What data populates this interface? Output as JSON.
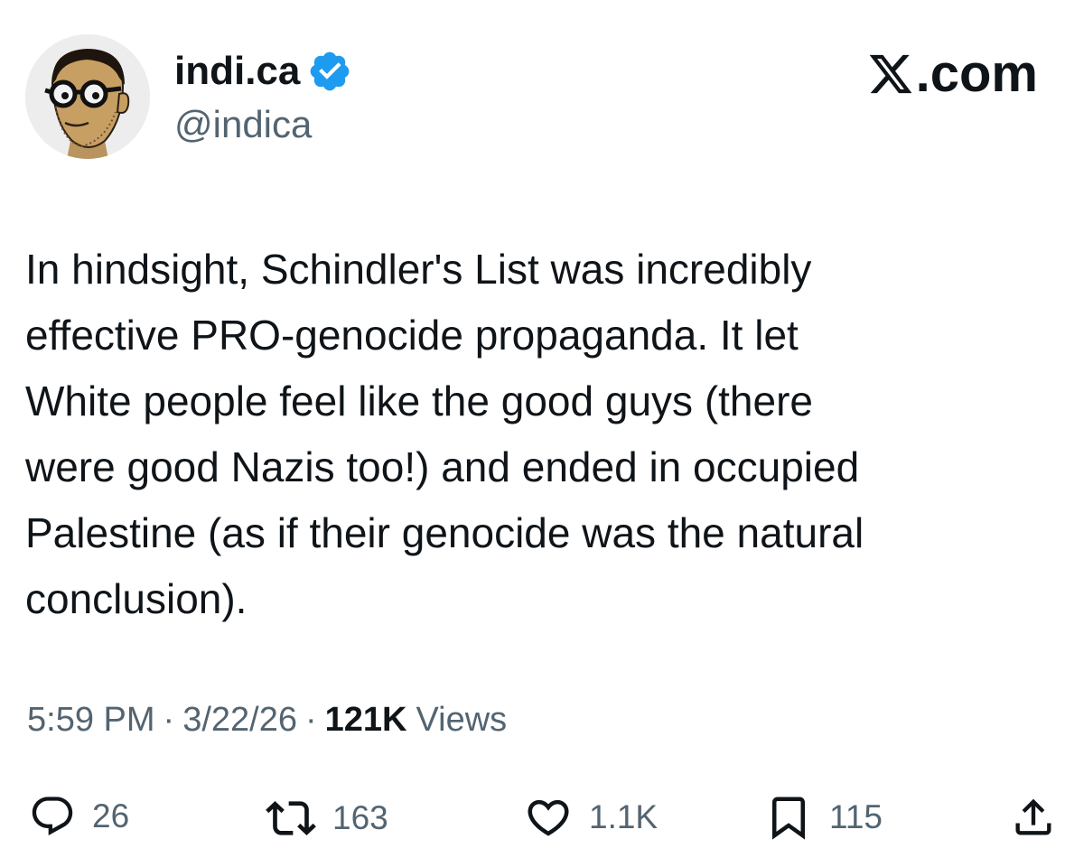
{
  "author": {
    "display_name": "indi.ca",
    "handle": "@indica",
    "verified": true,
    "avatar": "cartoon-man-with-glasses-and-beard"
  },
  "brand": {
    "logo": "x-logo-icon",
    "text": ".com"
  },
  "tweet": {
    "text": "In hindsight, Schindler's List was incredibly\neffective PRO-genocide propaganda. It let\nWhite people feel like the good guys (there\nwere good Nazis too!) and ended in occupied\nPalestine (as if their genocide was the natural\nconclusion)."
  },
  "meta": {
    "time": "5:59 PM",
    "date": "3/22/26",
    "separator": "·",
    "views_count": "121K",
    "views_label": "Views"
  },
  "actions": {
    "replies": {
      "icon": "reply-icon",
      "count": "26"
    },
    "reposts": {
      "icon": "repost-icon",
      "count": "163"
    },
    "likes": {
      "icon": "heart-icon",
      "count": "1.1K"
    },
    "bookmarks": {
      "icon": "bookmark-icon",
      "count": "115"
    },
    "share": {
      "icon": "share-icon"
    }
  },
  "colors": {
    "text": "#0f1419",
    "secondary": "#536471",
    "verified": "#1d9bf0",
    "background": "#ffffff"
  }
}
